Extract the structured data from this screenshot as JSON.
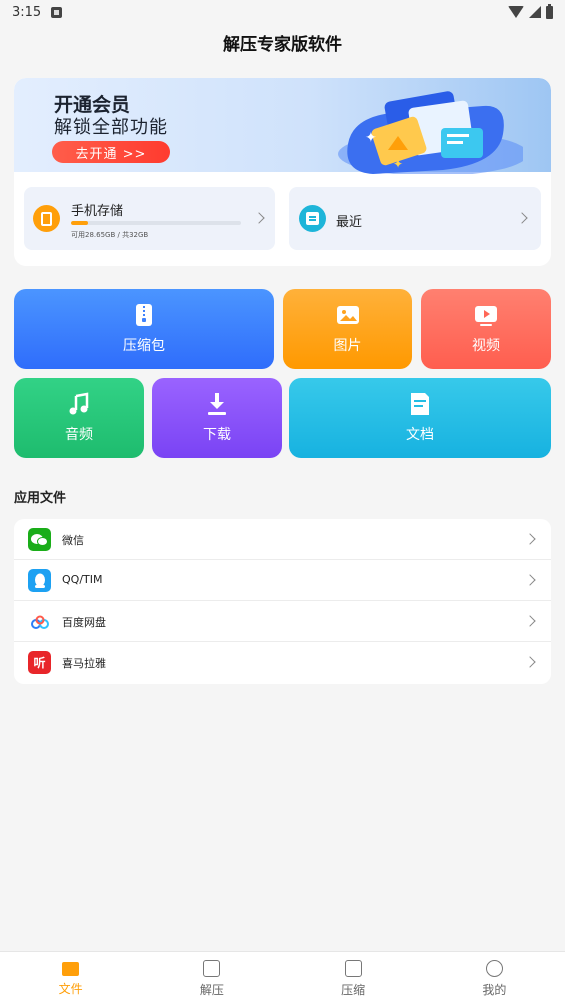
{
  "status_bar": {
    "time": "3:15"
  },
  "header": {
    "title": "解压专家版软件"
  },
  "banner": {
    "title": "开通会员",
    "subtitle": "解锁全部功能",
    "button_label": "去开通 >>"
  },
  "storage": {
    "label": "手机存储",
    "detail": "可用28.65GB / 共32GB",
    "used_fraction": 0.1
  },
  "recent": {
    "label": "最近"
  },
  "categories": [
    {
      "label": "压缩包",
      "icon": "zip-icon"
    },
    {
      "label": "图片",
      "icon": "image-icon"
    },
    {
      "label": "视频",
      "icon": "video-icon"
    },
    {
      "label": "音频",
      "icon": "music-icon"
    },
    {
      "label": "下载",
      "icon": "download-icon"
    },
    {
      "label": "文档",
      "icon": "document-icon"
    }
  ],
  "section": {
    "title": "应用文件"
  },
  "apps": [
    {
      "name": "微信",
      "icon": "wechat-icon",
      "color": "#1aad19"
    },
    {
      "name": "QQ/TIM",
      "icon": "qq-icon",
      "color": "#1da1f2"
    },
    {
      "name": "百度网盘",
      "icon": "baidu-netdisk-icon",
      "color": "#ffffff"
    },
    {
      "name": "喜马拉雅",
      "icon": "ximalaya-icon",
      "color": "#e8262a"
    }
  ],
  "bottom_nav": [
    {
      "label": "文件",
      "active": true
    },
    {
      "label": "解压",
      "active": false
    },
    {
      "label": "压缩",
      "active": false
    },
    {
      "label": "我的",
      "active": false
    }
  ],
  "colors": {
    "accent": "#ff9f0a",
    "banner_button": "#ff4536"
  }
}
